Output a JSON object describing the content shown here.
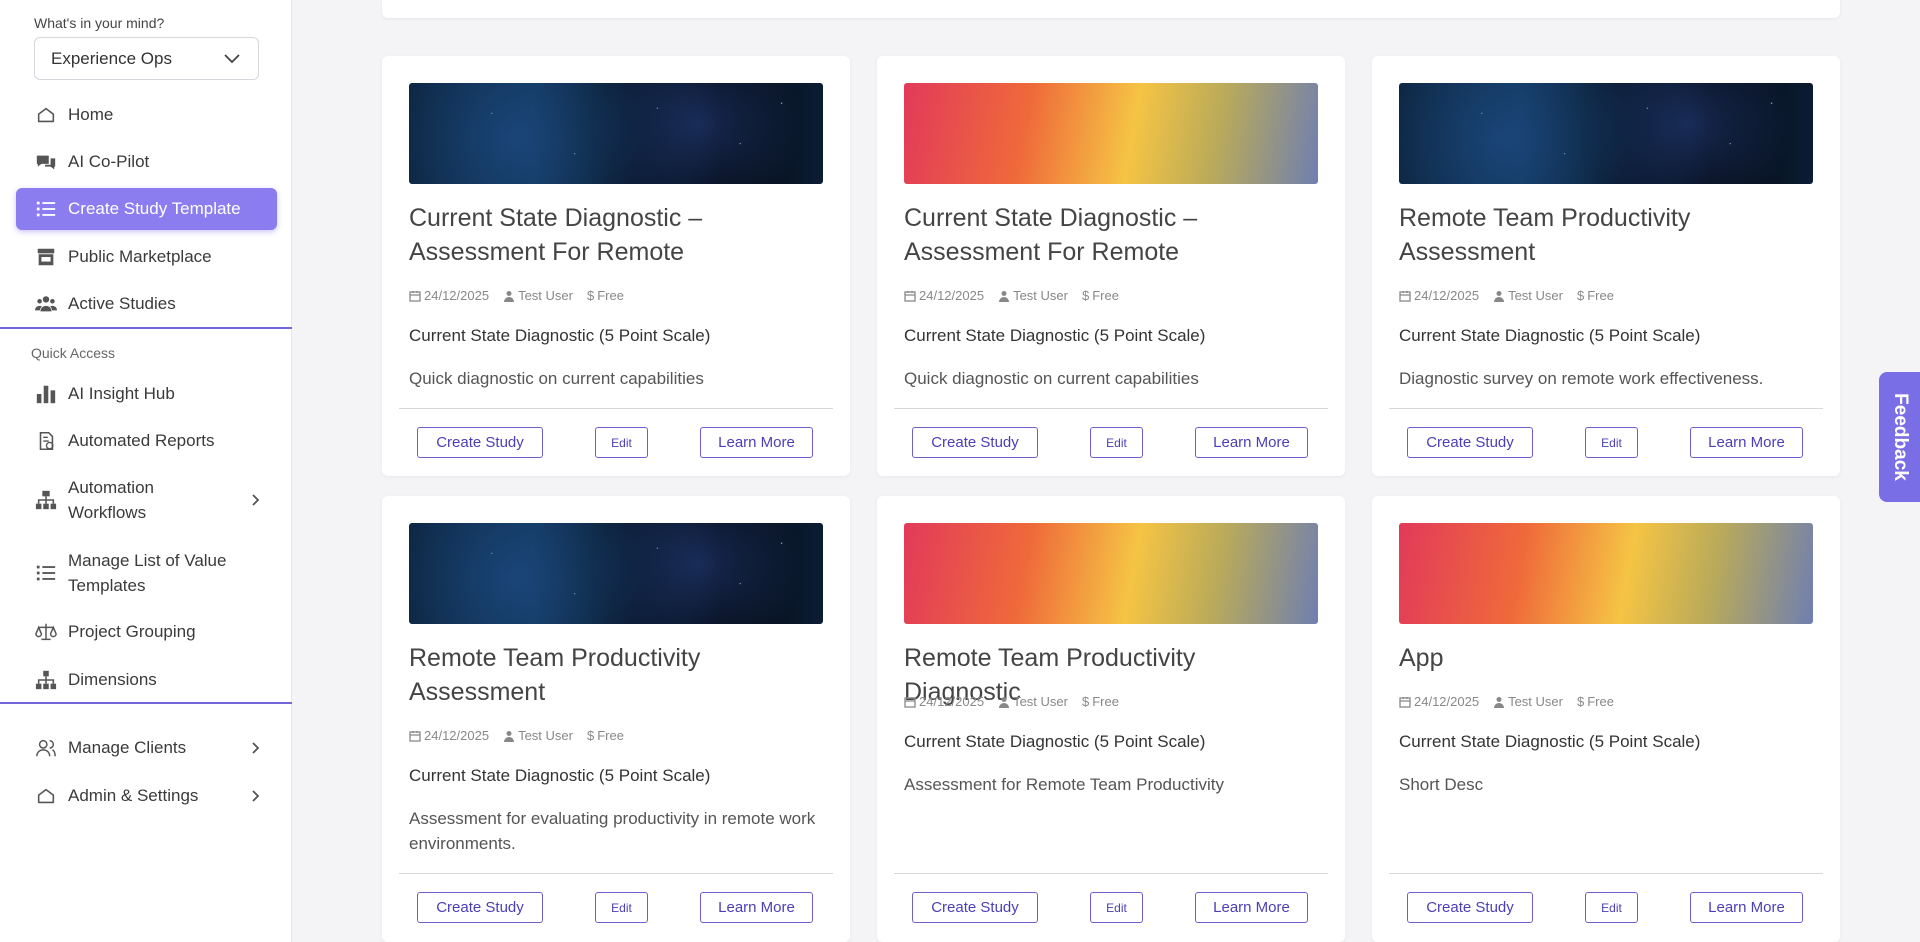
{
  "sidebar": {
    "mind_label": "What's in your mind?",
    "mind_select_value": "Experience Ops",
    "nav": {
      "home": "Home",
      "copilot": "AI Co-Pilot",
      "create_template": "Create Study Template",
      "marketplace": "Public Marketplace",
      "active_studies": "Active Studies"
    },
    "quick_access_label": "Quick Access",
    "quick": {
      "insight_hub": "AI Insight Hub",
      "automated_reports": "Automated Reports",
      "automation_workflows": "Automation Workflows",
      "manage_lov": "Manage List of Value Templates",
      "project_grouping": "Project Grouping",
      "dimensions": "Dimensions"
    },
    "bottom": {
      "manage_clients": "Manage Clients",
      "admin_settings": "Admin & Settings"
    },
    "accent_color": "#8b7cf0"
  },
  "cards": [
    {
      "title": "Current State Diagnostic – Assessment For Remote",
      "date": "24/12/2025",
      "user": "Test User",
      "price": "Free",
      "subtitle": "Current State Diagnostic (5 Point Scale)",
      "desc": "Quick diagnostic on current capabilities",
      "banner": "space"
    },
    {
      "title": "Current State Diagnostic – Assessment For Remote",
      "date": "24/12/2025",
      "user": "Test User",
      "price": "Free",
      "subtitle": "Current State Diagnostic (5 Point Scale)",
      "desc": "Quick diagnostic on current capabilities",
      "banner": "warm"
    },
    {
      "title": "Remote Team Productivity Assessment",
      "date": "24/12/2025",
      "user": "Test User",
      "price": "Free",
      "subtitle": "Current State Diagnostic (5 Point Scale)",
      "desc": "Diagnostic survey on remote work effectiveness.",
      "banner": "space"
    },
    {
      "title": "Remote Team Productivity Assessment",
      "date": "24/12/2025",
      "user": "Test User",
      "price": "Free",
      "subtitle": "Current State Diagnostic (5 Point Scale)",
      "desc": "Assessment for evaluating productivity in remote work environments.",
      "banner": "space"
    },
    {
      "title": "Remote Team Productivity Diagnostic",
      "date": "24/12/2025",
      "user": "Test User",
      "price": "Free",
      "subtitle": "Current State Diagnostic (5 Point Scale)",
      "desc": "Assessment for Remote Team Productivity",
      "banner": "warm"
    },
    {
      "title": "App",
      "date": "24/12/2025",
      "user": "Test User",
      "price": "Free",
      "subtitle": "Current State Diagnostic (5 Point Scale)",
      "desc": "Short Desc",
      "banner": "warm"
    }
  ],
  "buttons": {
    "create": "Create Study",
    "edit": "Edit",
    "learn": "Learn More"
  },
  "feedback_label": "Feedback"
}
